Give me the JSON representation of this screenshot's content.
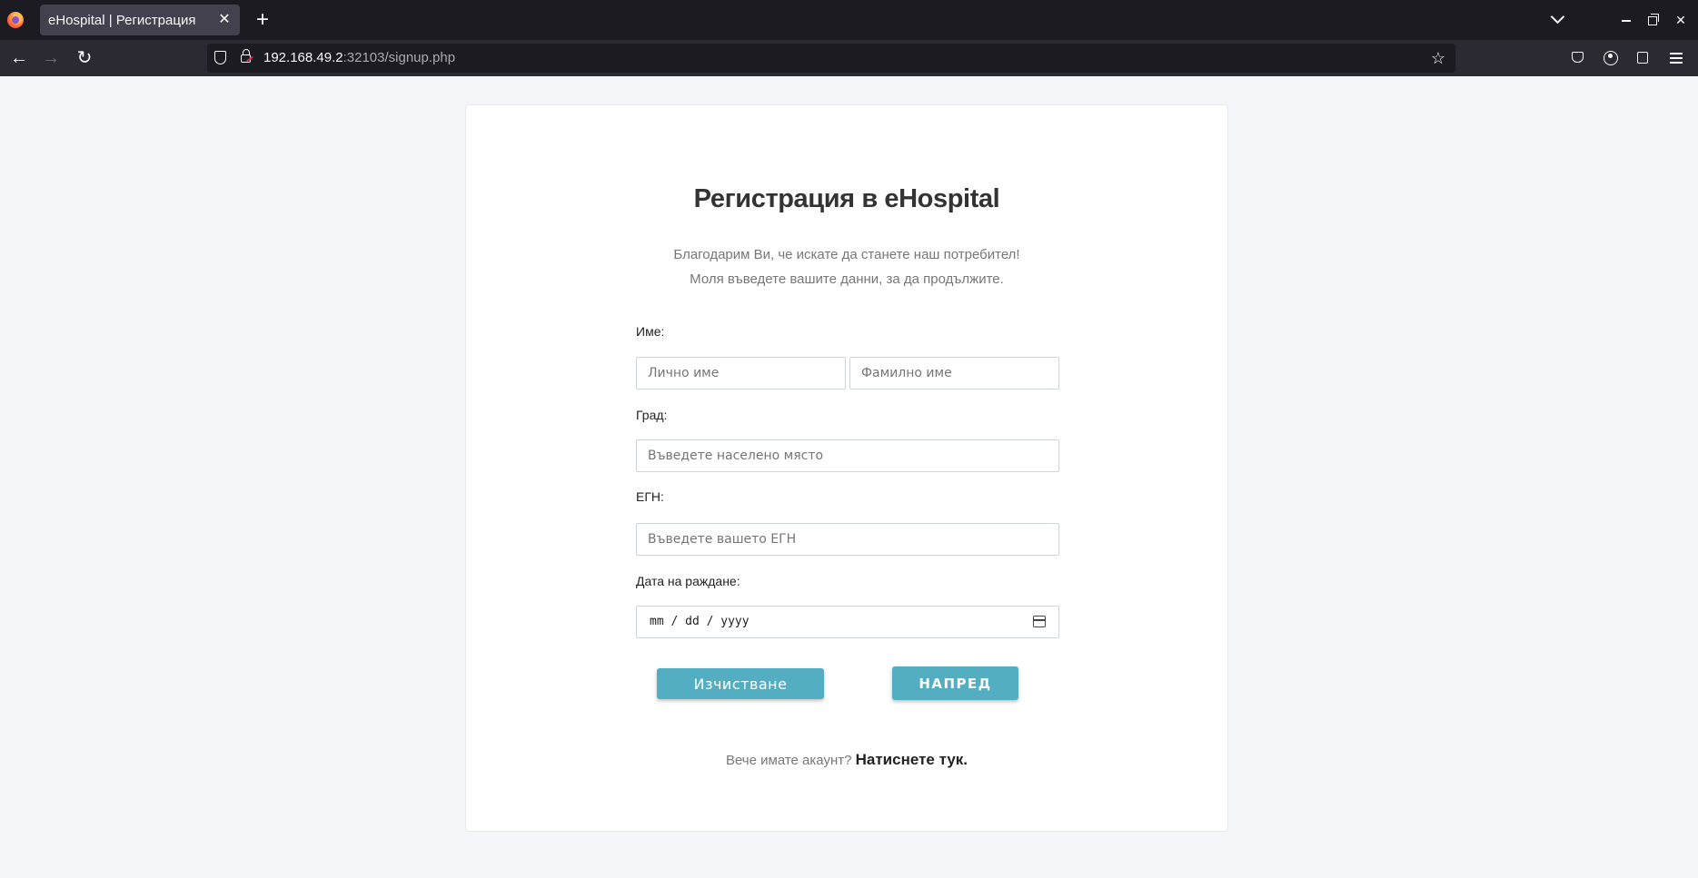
{
  "browser": {
    "tab_title": "eHospital | Регистрация",
    "url_host": "192.168.49.2",
    "url_rest": ":32103/signup.php"
  },
  "page": {
    "title": "Регистрация в eHospital",
    "subtitle_line1": "Благодарим Ви, че искате да станете наш потребител!",
    "subtitle_line2": "Моля въведете вашите данни, за да продължите.",
    "form": {
      "name_label": "Име:",
      "first_name_placeholder": "Лично име",
      "last_name_placeholder": "Фамилно име",
      "city_label": "Град:",
      "city_placeholder": "Въведете населено място",
      "egn_label": "ЕГН:",
      "egn_placeholder": "Въведете вашето ЕГН",
      "dob_label": "Дата на раждане:",
      "dob_placeholder": "mm / dd / yyyy",
      "clear_button": "Изчистване",
      "next_button": "НАПРЕД"
    },
    "footer": {
      "text": "Вече имате акаунт?",
      "link": "Натиснете тук."
    }
  },
  "colors": {
    "accent": "#52aec0",
    "page_bg": "#f5f6f9",
    "chrome_dark": "#1c1b22",
    "chrome_nav": "#2b2a33"
  }
}
